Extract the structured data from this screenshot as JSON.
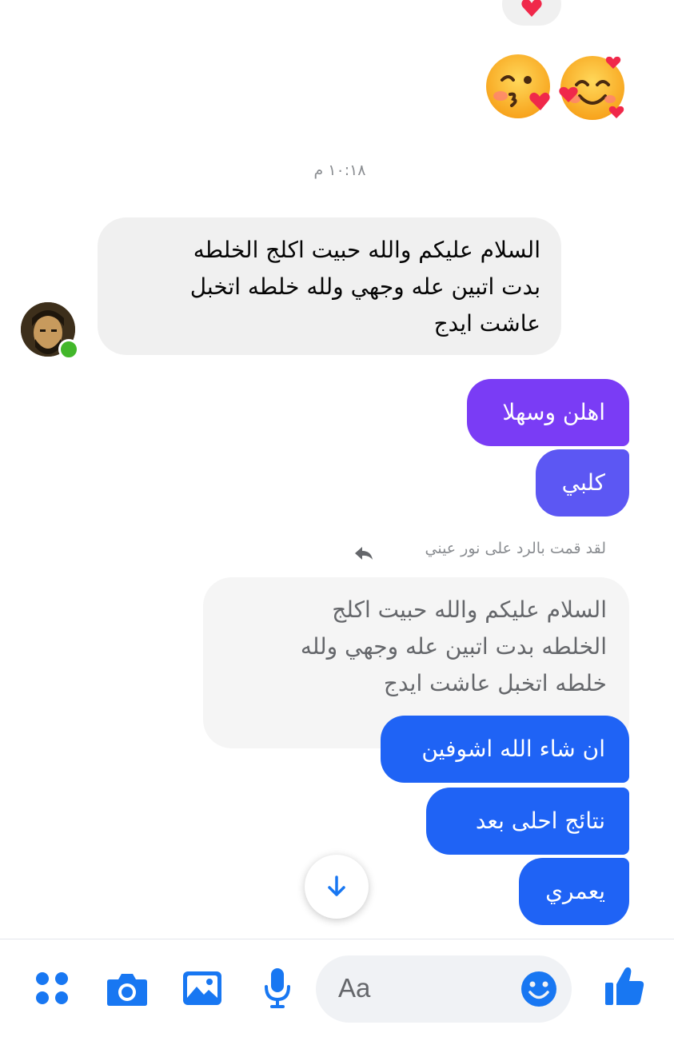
{
  "conversation": {
    "timestamp": "١٠:١٨ م",
    "incoming_message": {
      "lines": [
        "السلام عليكم والله حبيت اكلج الخلطه",
        "بدت اتبين عله وجهي ولله خلطه اتخبل",
        "عاشت ايدج"
      ],
      "sender_online": true
    },
    "outgoing_messages": [
      {
        "text": "اهلن وسهلا",
        "color": "#7a3cf5"
      },
      {
        "text": "كلبي",
        "color": "#5c57f3"
      }
    ],
    "reply": {
      "label": "لقد قمت بالرد على نور عيني",
      "quoted_lines": [
        "السلام عليكم والله حبيت اكلج",
        "الخلطه بدت اتبين عله وجهي ولله",
        "خلطه اتخبل عاشت ايدج"
      ]
    },
    "reply_messages": [
      {
        "text": "ان شاء الله اشوفين",
        "color": "#1f63f5"
      },
      {
        "text": "نتائج احلى بعد",
        "color": "#1f63f5"
      },
      {
        "text": "يعمري",
        "color": "#1f63f5"
      }
    ],
    "reactions": [
      "heart-icon",
      "kissing-heart-emoji",
      "smiling-face-with-hearts-emoji"
    ]
  },
  "composer": {
    "placeholder": "Aa",
    "icons": [
      "apps-icon",
      "camera-icon",
      "gallery-icon",
      "microphone-icon",
      "emoji-icon",
      "thumbs-up-icon"
    ],
    "accent_color": "#1877f2"
  }
}
